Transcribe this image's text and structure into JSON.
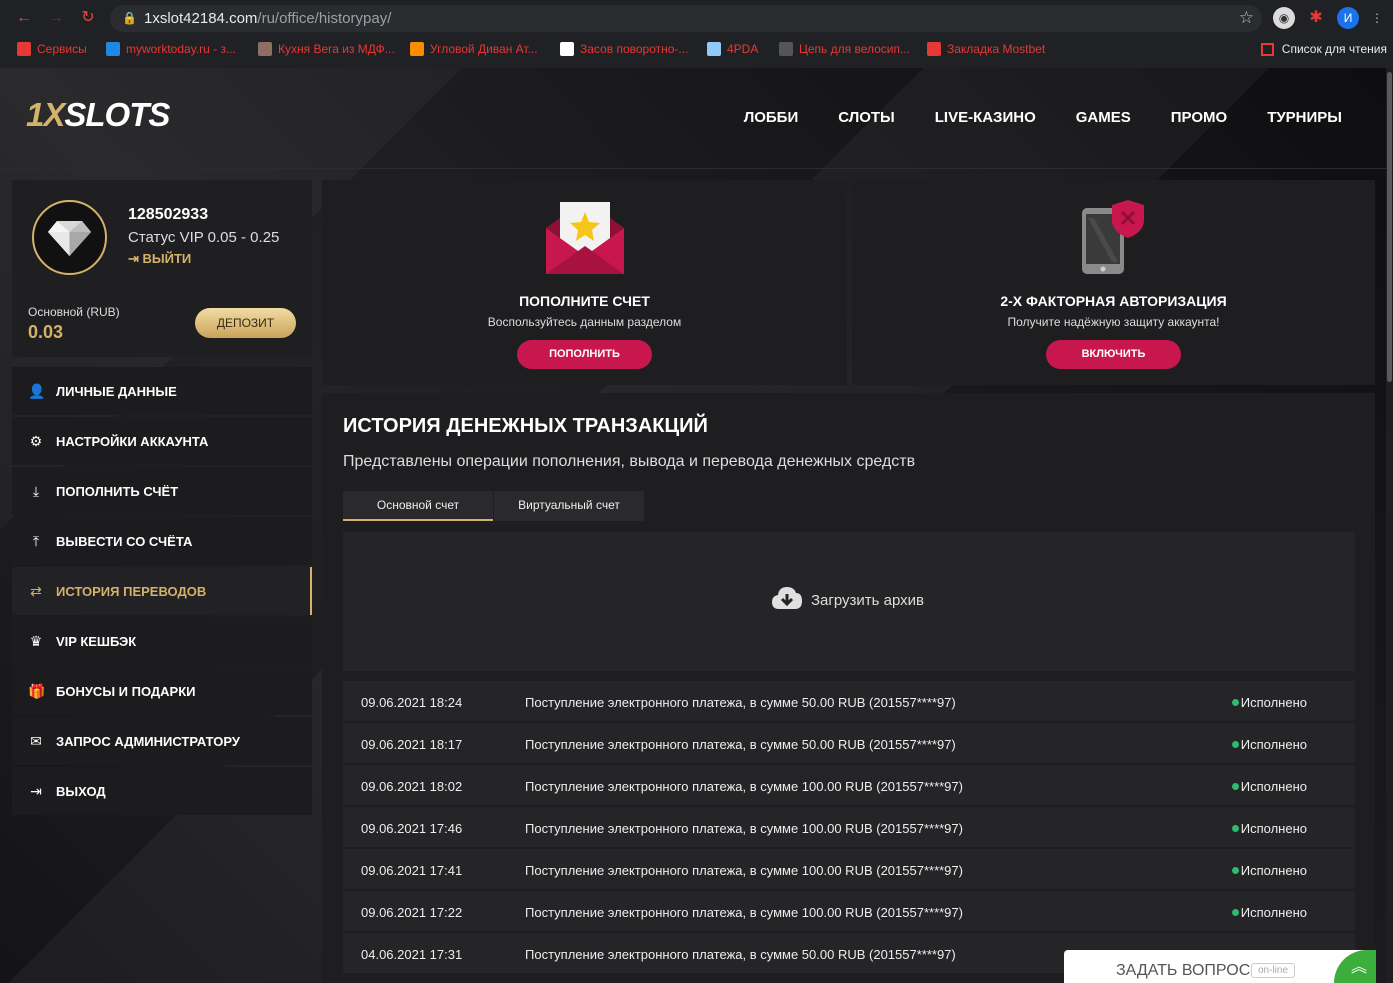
{
  "browser": {
    "url_host": "1xslot42184.com",
    "url_path": "/ru/office/historypay/",
    "profile_initial": "И",
    "bookmarks": [
      {
        "label": "Сервисы",
        "color": "#e53935"
      },
      {
        "label": "myworktoday.ru - з...",
        "color": "#1e88e5"
      },
      {
        "label": "Кухня Вега из МДФ...",
        "color": "#8d6e63"
      },
      {
        "label": "Угловой Диван Ат...",
        "color": "#fb8c00"
      },
      {
        "label": "Засов поворотно-...",
        "color": "#ffffff"
      },
      {
        "label": "4PDA",
        "color": "#90caf9"
      },
      {
        "label": "Цепь для велосип...",
        "color": "#555555"
      },
      {
        "label": "Закладка Mostbet",
        "color": "#e53935"
      }
    ],
    "reading_list": "Список для чтения"
  },
  "header": {
    "logo_prefix": "1X",
    "logo_suffix": "SLOTS",
    "nav": [
      "ЛОББИ",
      "СЛОТЫ",
      "LIVE-КАЗИНО",
      "GAMES",
      "ПРОМО",
      "ТУРНИРЫ"
    ]
  },
  "profile": {
    "user_id": "128502933",
    "vip_status": "Статус VIP 0.05 - 0.25",
    "logout_label": "ВЫЙТИ",
    "balance_label": "Основной (RUB)",
    "balance_value": "0.03",
    "deposit_label": "ДЕПОЗИТ"
  },
  "menu": [
    {
      "label": "ЛИЧНЫЕ ДАННЫЕ",
      "icon": "user-plus-icon",
      "glyph": "👤",
      "active": false
    },
    {
      "label": "НАСТРОЙКИ АККАУНТА",
      "icon": "gears-icon",
      "glyph": "⚙",
      "active": false
    },
    {
      "label": "ПОПОЛНИТЬ СЧЁТ",
      "icon": "download-icon",
      "glyph": "⤓",
      "active": false
    },
    {
      "label": "ВЫВЕСТИ СО СЧЁТА",
      "icon": "upload-icon",
      "glyph": "⤒",
      "active": false
    },
    {
      "label": "ИСТОРИЯ ПЕРЕВОДОВ",
      "icon": "exchange-icon",
      "glyph": "⇄",
      "active": true
    },
    {
      "label": "VIP КЕШБЭК",
      "icon": "crown-icon",
      "glyph": "♛",
      "active": false
    },
    {
      "label": "БОНУСЫ И ПОДАРКИ",
      "icon": "gift-icon",
      "glyph": "🎁",
      "active": false
    },
    {
      "label": "ЗАПРОС АДМИНИСТРАТОРУ",
      "icon": "envelope-icon",
      "glyph": "✉",
      "active": false
    },
    {
      "label": "ВЫХОД",
      "icon": "sign-out-icon",
      "glyph": "⇥",
      "active": false
    }
  ],
  "promo": {
    "deposit": {
      "title": "ПОПОЛНИТЕ СЧЕТ",
      "subtitle": "Воспользуйтесь данным разделом",
      "button": "ПОПОЛНИТЬ"
    },
    "twofa": {
      "title": "2-Х ФАКТОРНАЯ АВТОРИЗАЦИЯ",
      "subtitle": "Получите надёжную защиту аккаунта!",
      "button": "ВКЛЮЧИТЬ"
    }
  },
  "history": {
    "title": "ИСТОРИЯ ДЕНЕЖНЫХ ТРАНЗАКЦИЙ",
    "subtitle": "Представлены операции пополнения, вывода и перевода денежных средств",
    "tabs": [
      "Основной счет",
      "Виртуальный счет"
    ],
    "archive_label": "Загрузить архив",
    "transactions": [
      {
        "date": "09.06.2021 18:24",
        "description": "Поступление электронного платежа, в сумме 50.00 RUB (201557****97)",
        "status": "Исполнено"
      },
      {
        "date": "09.06.2021 18:17",
        "description": "Поступление электронного платежа, в сумме 50.00 RUB (201557****97)",
        "status": "Исполнено"
      },
      {
        "date": "09.06.2021 18:02",
        "description": "Поступление электронного платежа, в сумме 100.00 RUB (201557****97)",
        "status": "Исполнено"
      },
      {
        "date": "09.06.2021 17:46",
        "description": "Поступление электронного платежа, в сумме 100.00 RUB (201557****97)",
        "status": "Исполнено"
      },
      {
        "date": "09.06.2021 17:41",
        "description": "Поступление электронного платежа, в сумме 100.00 RUB (201557****97)",
        "status": "Исполнено"
      },
      {
        "date": "09.06.2021 17:22",
        "description": "Поступление электронного платежа, в сумме 100.00 RUB (201557****97)",
        "status": "Исполнено"
      },
      {
        "date": "04.06.2021 17:31",
        "description": "Поступление электронного платежа, в сумме 50.00 RUB (201557****97)",
        "status": ""
      }
    ]
  },
  "chat": {
    "label": "ЗАДАТЬ ВОПРОС",
    "badge": "on-line"
  },
  "colors": {
    "gold": "#d4b26a",
    "accent_red": "#c8174f",
    "status_green": "#2dbb6d"
  }
}
